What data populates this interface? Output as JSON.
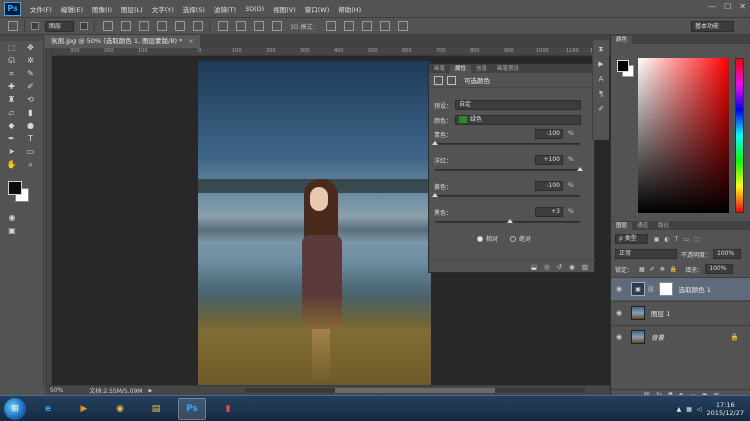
{
  "menubar": {
    "logo": "Ps",
    "items": [
      "文件(F)",
      "编辑(E)",
      "图像(I)",
      "图层(L)",
      "文字(Y)",
      "选择(S)",
      "滤镜(T)",
      "3D(D)",
      "视图(V)",
      "窗口(W)",
      "帮助(H)"
    ],
    "window_controls": [
      "—",
      "☐",
      "✕"
    ]
  },
  "options_bar": {
    "mode_select": "图层",
    "mode_3d_label": "3D 模式：",
    "workspace": "基本功能"
  },
  "document": {
    "tab_title": "氛围.jpg @ 50% (选取颜色 1, 图层蒙版/8) *",
    "close": "×",
    "ruler_ticks": [
      "300",
      "200",
      "100",
      "0",
      "100",
      "200",
      "300",
      "400",
      "500",
      "600",
      "700",
      "800",
      "900",
      "1000",
      "1100",
      "1200"
    ]
  },
  "properties": {
    "tabs": [
      "画笔",
      "属性",
      "信息",
      "画笔预设"
    ],
    "active_tab": 1,
    "title": "可选颜色",
    "preset_label": "预设：",
    "preset_value": "自定",
    "colors_label": "颜色：",
    "colors_value": "绿色",
    "sliders": [
      {
        "label": "青色：",
        "value": "-100",
        "unit": "%",
        "level": 0.0
      },
      {
        "label": "洋红：",
        "value": "+100",
        "unit": "%",
        "level": 1.0
      },
      {
        "label": "黄色：",
        "value": "-100",
        "unit": "%",
        "level": 0.0
      },
      {
        "label": "黑色：",
        "value": "+3",
        "unit": "%",
        "level": 0.515
      }
    ],
    "radio_relative": "相对",
    "radio_absolute": "绝对",
    "radio_selected": "relative",
    "footer_icons": [
      "clip-icon",
      "eye-toggle-icon",
      "reset-icon",
      "visibility-icon",
      "trash-icon"
    ]
  },
  "color_panel": {
    "tabs": [
      "颜色"
    ],
    "foreground": "#000000",
    "background": "#ffffff"
  },
  "layers_panel": {
    "tabs": [
      "图层",
      "通道",
      "路径"
    ],
    "kind_filter": "ρ 类型",
    "blend_mode": "正常",
    "opacity_label": "不透明度：",
    "opacity_value": "100%",
    "lock_label": "锁定：",
    "fill_label": "填充：",
    "fill_value": "100%",
    "layers": [
      {
        "name": "选取颜色 1",
        "type": "adjustment",
        "selected": true
      },
      {
        "name": "图层 1",
        "type": "pixel",
        "selected": false
      },
      {
        "name": "背景",
        "type": "background",
        "selected": false,
        "locked": true
      }
    ],
    "footer_icons": [
      "link-icon",
      "fx-icon",
      "mask-icon",
      "adjustment-icon",
      "group-icon",
      "new-layer-icon",
      "trash-icon"
    ]
  },
  "status_bar": {
    "zoom": "50%",
    "doc_info": "文档:2.55M/5.09M"
  },
  "taskbar": {
    "time": "17:16",
    "date": "2015/12/27"
  }
}
